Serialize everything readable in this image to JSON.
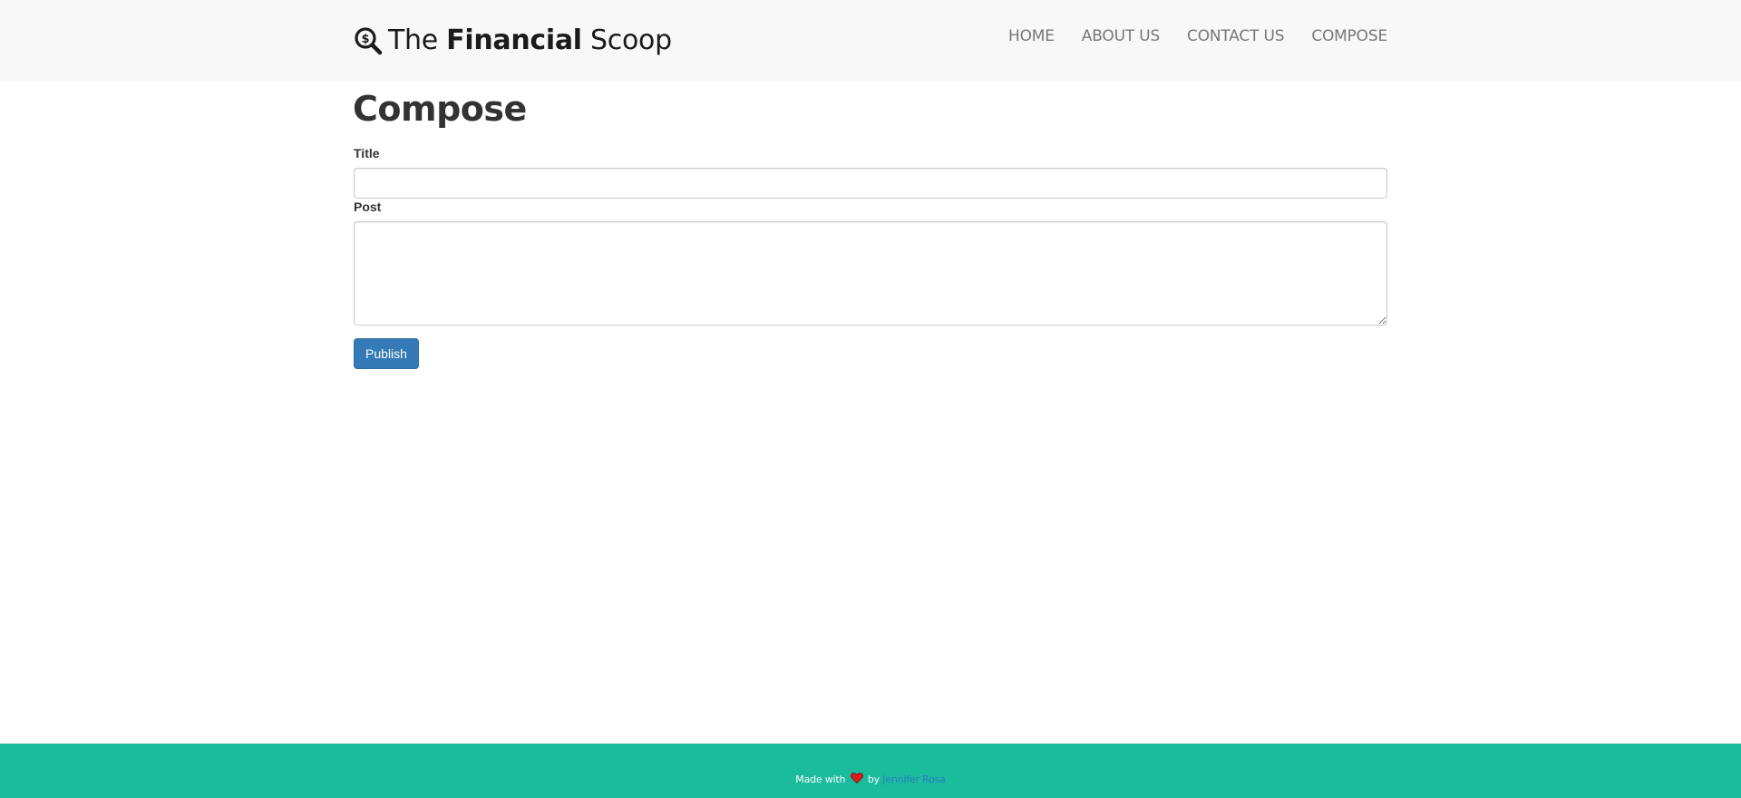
{
  "brand": {
    "icon": "magnifier-dollar-icon",
    "prefix": "The",
    "bold": "Financial",
    "suffix": "Scoop"
  },
  "nav": {
    "items": [
      {
        "label": "HOME"
      },
      {
        "label": "ABOUT US"
      },
      {
        "label": "CONTACT US"
      },
      {
        "label": "COMPOSE"
      }
    ]
  },
  "main": {
    "title": "Compose",
    "title_field_label": "Title",
    "title_field_value": "",
    "post_field_label": "Post",
    "post_field_value": "",
    "publish_label": "Publish"
  },
  "footer": {
    "made_with": "Made with",
    "heart_icon": "heart-icon",
    "by": "by",
    "author": "Jennifer Rosa"
  },
  "colors": {
    "navbar_bg": "#f8f8f8",
    "footer_bg": "#1abc9c",
    "primary_button": "#337ab7",
    "heart": "#e01a1a",
    "author_link": "#2a7bc0"
  }
}
